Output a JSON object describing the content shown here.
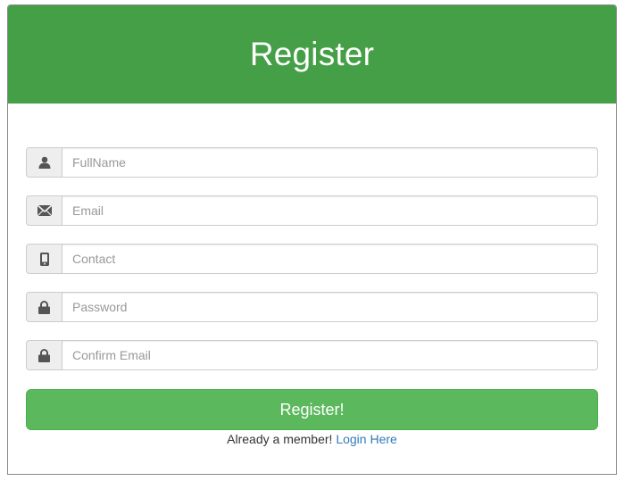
{
  "header": {
    "title": "Register"
  },
  "form": {
    "fields": [
      {
        "placeholder": "FullName",
        "icon": "user-icon"
      },
      {
        "placeholder": "Email",
        "icon": "envelope-icon"
      },
      {
        "placeholder": "Contact",
        "icon": "phone-icon"
      },
      {
        "placeholder": "Password",
        "icon": "lock-icon"
      },
      {
        "placeholder": "Confirm Email",
        "icon": "lock-icon"
      }
    ],
    "submit_label": "Register!",
    "login_prompt": "Already a member!",
    "login_link": "Login Here"
  },
  "colors": {
    "header_bg": "#449f46",
    "button_bg": "#5cb85c",
    "link": "#337ab7"
  }
}
